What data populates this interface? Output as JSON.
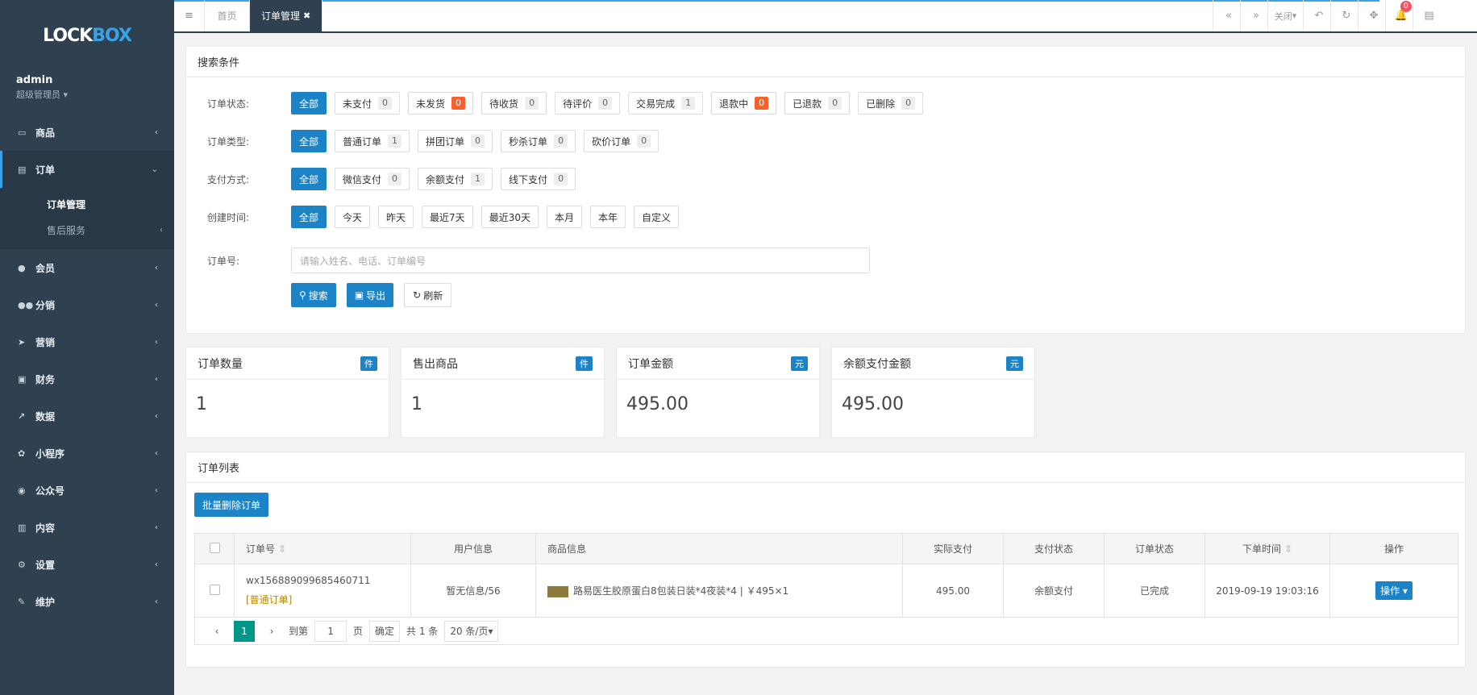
{
  "app": {
    "logo_a": "LOCK",
    "logo_b": "BOX"
  },
  "user": {
    "name": "admin",
    "role": "超级管理员"
  },
  "menu": [
    {
      "label": "商品",
      "icon": "laptop-icon"
    },
    {
      "label": "订单",
      "icon": "order-icon"
    },
    {
      "label": "会员",
      "icon": "user-icon"
    },
    {
      "label": "分销",
      "icon": "users-icon"
    },
    {
      "label": "营销",
      "icon": "send-icon"
    },
    {
      "label": "财务",
      "icon": "money-icon"
    },
    {
      "label": "数据",
      "icon": "chart-icon"
    },
    {
      "label": "小程序",
      "icon": "share-icon"
    },
    {
      "label": "公众号",
      "icon": "wechat-icon"
    },
    {
      "label": "内容",
      "icon": "book-icon"
    },
    {
      "label": "设置",
      "icon": "gear-icon"
    },
    {
      "label": "维护",
      "icon": "wrench-icon"
    }
  ],
  "submenu": [
    {
      "label": "订单管理"
    },
    {
      "label": "售后服务"
    }
  ],
  "tabs": {
    "home": "首页",
    "current": "订单管理",
    "close_menu": "关闭",
    "notify_count": "0"
  },
  "search": {
    "title": "搜索条件",
    "rows": [
      {
        "label": "订单状态:",
        "options": [
          {
            "text": "全部"
          },
          {
            "text": "未支付",
            "count": "0"
          },
          {
            "text": "未发货",
            "count": "0",
            "hot": true
          },
          {
            "text": "待收货",
            "count": "0"
          },
          {
            "text": "待评价",
            "count": "0"
          },
          {
            "text": "交易完成",
            "count": "1"
          },
          {
            "text": "退款中",
            "count": "0",
            "hot": true
          },
          {
            "text": "已退款",
            "count": "0"
          },
          {
            "text": "已删除",
            "count": "0"
          }
        ]
      },
      {
        "label": "订单类型:",
        "options": [
          {
            "text": "全部"
          },
          {
            "text": "普通订单",
            "count": "1"
          },
          {
            "text": "拼团订单",
            "count": "0"
          },
          {
            "text": "秒杀订单",
            "count": "0"
          },
          {
            "text": "砍价订单",
            "count": "0"
          }
        ]
      },
      {
        "label": "支付方式:",
        "options": [
          {
            "text": "全部"
          },
          {
            "text": "微信支付",
            "count": "0"
          },
          {
            "text": "余额支付",
            "count": "1"
          },
          {
            "text": "线下支付",
            "count": "0"
          }
        ]
      },
      {
        "label": "创建时间:",
        "options": [
          {
            "text": "全部"
          },
          {
            "text": "今天"
          },
          {
            "text": "昨天"
          },
          {
            "text": "最近7天"
          },
          {
            "text": "最近30天"
          },
          {
            "text": "本月"
          },
          {
            "text": "本年"
          },
          {
            "text": "自定义"
          }
        ]
      }
    ],
    "order_no_label": "订单号:",
    "order_no_placeholder": "请输入姓名、电话、订单编号",
    "btn_search": "搜索",
    "btn_export": "导出",
    "btn_refresh": "刷新"
  },
  "stats": [
    {
      "title": "订单数量",
      "badge": "件",
      "value": "1"
    },
    {
      "title": "售出商品",
      "badge": "件",
      "value": "1"
    },
    {
      "title": "订单金额",
      "badge": "元",
      "value": "495.00"
    },
    {
      "title": "余额支付金额",
      "badge": "元",
      "value": "495.00"
    }
  ],
  "list": {
    "title": "订单列表",
    "batch_delete": "批量删除订单",
    "columns": [
      "订单号",
      "用户信息",
      "商品信息",
      "实际支付",
      "支付状态",
      "订单状态",
      "下单时间",
      "操作"
    ],
    "rows": [
      {
        "order_no": "wx156889099685460711",
        "type": "[普通订单]",
        "user": "暂无信息/56",
        "product": "路易医生胶原蛋白8包装日装*4夜装*4 | ￥495×1",
        "paid": "495.00",
        "pay_status": "余额支付",
        "order_status": "已完成",
        "time": "2019-09-19 19:03:16",
        "action": "操作"
      }
    ]
  },
  "pagination": {
    "current": "1",
    "goto_label": "到第",
    "goto_value": "1",
    "page_unit": "页",
    "confirm": "确定",
    "total": "共 1 条",
    "page_size": "20 条/页"
  }
}
